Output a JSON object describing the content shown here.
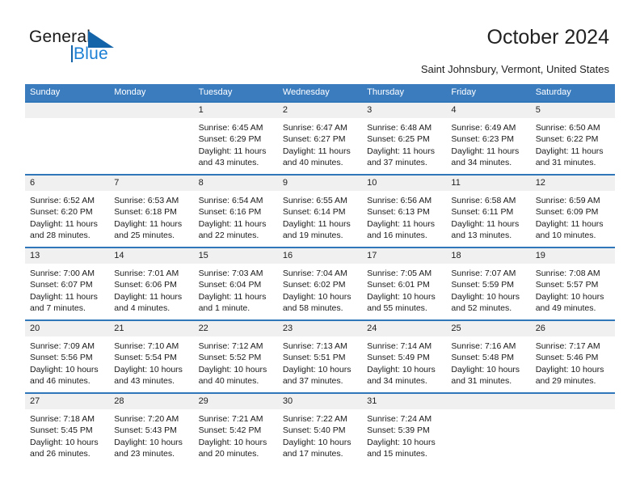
{
  "brand": {
    "name_part1": "General",
    "name_part2": "Blue",
    "accent_color": "#1b7fd4",
    "triangle_color": "#1464aa",
    "logo_icon": "blue-triangle-icon"
  },
  "header": {
    "title": "October 2024",
    "subtitle": "Saint Johnsbury, Vermont, United States"
  },
  "calendar": {
    "header_bg": "#3b7cbf",
    "row_border_color": "#2f77b8",
    "daynum_bg": "#f0f0f0",
    "weekdays": [
      "Sunday",
      "Monday",
      "Tuesday",
      "Wednesday",
      "Thursday",
      "Friday",
      "Saturday"
    ],
    "weeks": [
      [
        {
          "day": "",
          "sunrise": "",
          "sunset": "",
          "daylight1": "",
          "daylight2": ""
        },
        {
          "day": "",
          "sunrise": "",
          "sunset": "",
          "daylight1": "",
          "daylight2": ""
        },
        {
          "day": "1",
          "sunrise": "Sunrise: 6:45 AM",
          "sunset": "Sunset: 6:29 PM",
          "daylight1": "Daylight: 11 hours",
          "daylight2": "and 43 minutes."
        },
        {
          "day": "2",
          "sunrise": "Sunrise: 6:47 AM",
          "sunset": "Sunset: 6:27 PM",
          "daylight1": "Daylight: 11 hours",
          "daylight2": "and 40 minutes."
        },
        {
          "day": "3",
          "sunrise": "Sunrise: 6:48 AM",
          "sunset": "Sunset: 6:25 PM",
          "daylight1": "Daylight: 11 hours",
          "daylight2": "and 37 minutes."
        },
        {
          "day": "4",
          "sunrise": "Sunrise: 6:49 AM",
          "sunset": "Sunset: 6:23 PM",
          "daylight1": "Daylight: 11 hours",
          "daylight2": "and 34 minutes."
        },
        {
          "day": "5",
          "sunrise": "Sunrise: 6:50 AM",
          "sunset": "Sunset: 6:22 PM",
          "daylight1": "Daylight: 11 hours",
          "daylight2": "and 31 minutes."
        }
      ],
      [
        {
          "day": "6",
          "sunrise": "Sunrise: 6:52 AM",
          "sunset": "Sunset: 6:20 PM",
          "daylight1": "Daylight: 11 hours",
          "daylight2": "and 28 minutes."
        },
        {
          "day": "7",
          "sunrise": "Sunrise: 6:53 AM",
          "sunset": "Sunset: 6:18 PM",
          "daylight1": "Daylight: 11 hours",
          "daylight2": "and 25 minutes."
        },
        {
          "day": "8",
          "sunrise": "Sunrise: 6:54 AM",
          "sunset": "Sunset: 6:16 PM",
          "daylight1": "Daylight: 11 hours",
          "daylight2": "and 22 minutes."
        },
        {
          "day": "9",
          "sunrise": "Sunrise: 6:55 AM",
          "sunset": "Sunset: 6:14 PM",
          "daylight1": "Daylight: 11 hours",
          "daylight2": "and 19 minutes."
        },
        {
          "day": "10",
          "sunrise": "Sunrise: 6:56 AM",
          "sunset": "Sunset: 6:13 PM",
          "daylight1": "Daylight: 11 hours",
          "daylight2": "and 16 minutes."
        },
        {
          "day": "11",
          "sunrise": "Sunrise: 6:58 AM",
          "sunset": "Sunset: 6:11 PM",
          "daylight1": "Daylight: 11 hours",
          "daylight2": "and 13 minutes."
        },
        {
          "day": "12",
          "sunrise": "Sunrise: 6:59 AM",
          "sunset": "Sunset: 6:09 PM",
          "daylight1": "Daylight: 11 hours",
          "daylight2": "and 10 minutes."
        }
      ],
      [
        {
          "day": "13",
          "sunrise": "Sunrise: 7:00 AM",
          "sunset": "Sunset: 6:07 PM",
          "daylight1": "Daylight: 11 hours",
          "daylight2": "and 7 minutes."
        },
        {
          "day": "14",
          "sunrise": "Sunrise: 7:01 AM",
          "sunset": "Sunset: 6:06 PM",
          "daylight1": "Daylight: 11 hours",
          "daylight2": "and 4 minutes."
        },
        {
          "day": "15",
          "sunrise": "Sunrise: 7:03 AM",
          "sunset": "Sunset: 6:04 PM",
          "daylight1": "Daylight: 11 hours",
          "daylight2": "and 1 minute."
        },
        {
          "day": "16",
          "sunrise": "Sunrise: 7:04 AM",
          "sunset": "Sunset: 6:02 PM",
          "daylight1": "Daylight: 10 hours",
          "daylight2": "and 58 minutes."
        },
        {
          "day": "17",
          "sunrise": "Sunrise: 7:05 AM",
          "sunset": "Sunset: 6:01 PM",
          "daylight1": "Daylight: 10 hours",
          "daylight2": "and 55 minutes."
        },
        {
          "day": "18",
          "sunrise": "Sunrise: 7:07 AM",
          "sunset": "Sunset: 5:59 PM",
          "daylight1": "Daylight: 10 hours",
          "daylight2": "and 52 minutes."
        },
        {
          "day": "19",
          "sunrise": "Sunrise: 7:08 AM",
          "sunset": "Sunset: 5:57 PM",
          "daylight1": "Daylight: 10 hours",
          "daylight2": "and 49 minutes."
        }
      ],
      [
        {
          "day": "20",
          "sunrise": "Sunrise: 7:09 AM",
          "sunset": "Sunset: 5:56 PM",
          "daylight1": "Daylight: 10 hours",
          "daylight2": "and 46 minutes."
        },
        {
          "day": "21",
          "sunrise": "Sunrise: 7:10 AM",
          "sunset": "Sunset: 5:54 PM",
          "daylight1": "Daylight: 10 hours",
          "daylight2": "and 43 minutes."
        },
        {
          "day": "22",
          "sunrise": "Sunrise: 7:12 AM",
          "sunset": "Sunset: 5:52 PM",
          "daylight1": "Daylight: 10 hours",
          "daylight2": "and 40 minutes."
        },
        {
          "day": "23",
          "sunrise": "Sunrise: 7:13 AM",
          "sunset": "Sunset: 5:51 PM",
          "daylight1": "Daylight: 10 hours",
          "daylight2": "and 37 minutes."
        },
        {
          "day": "24",
          "sunrise": "Sunrise: 7:14 AM",
          "sunset": "Sunset: 5:49 PM",
          "daylight1": "Daylight: 10 hours",
          "daylight2": "and 34 minutes."
        },
        {
          "day": "25",
          "sunrise": "Sunrise: 7:16 AM",
          "sunset": "Sunset: 5:48 PM",
          "daylight1": "Daylight: 10 hours",
          "daylight2": "and 31 minutes."
        },
        {
          "day": "26",
          "sunrise": "Sunrise: 7:17 AM",
          "sunset": "Sunset: 5:46 PM",
          "daylight1": "Daylight: 10 hours",
          "daylight2": "and 29 minutes."
        }
      ],
      [
        {
          "day": "27",
          "sunrise": "Sunrise: 7:18 AM",
          "sunset": "Sunset: 5:45 PM",
          "daylight1": "Daylight: 10 hours",
          "daylight2": "and 26 minutes."
        },
        {
          "day": "28",
          "sunrise": "Sunrise: 7:20 AM",
          "sunset": "Sunset: 5:43 PM",
          "daylight1": "Daylight: 10 hours",
          "daylight2": "and 23 minutes."
        },
        {
          "day": "29",
          "sunrise": "Sunrise: 7:21 AM",
          "sunset": "Sunset: 5:42 PM",
          "daylight1": "Daylight: 10 hours",
          "daylight2": "and 20 minutes."
        },
        {
          "day": "30",
          "sunrise": "Sunrise: 7:22 AM",
          "sunset": "Sunset: 5:40 PM",
          "daylight1": "Daylight: 10 hours",
          "daylight2": "and 17 minutes."
        },
        {
          "day": "31",
          "sunrise": "Sunrise: 7:24 AM",
          "sunset": "Sunset: 5:39 PM",
          "daylight1": "Daylight: 10 hours",
          "daylight2": "and 15 minutes."
        },
        {
          "day": "",
          "sunrise": "",
          "sunset": "",
          "daylight1": "",
          "daylight2": ""
        },
        {
          "day": "",
          "sunrise": "",
          "sunset": "",
          "daylight1": "",
          "daylight2": ""
        }
      ]
    ]
  }
}
